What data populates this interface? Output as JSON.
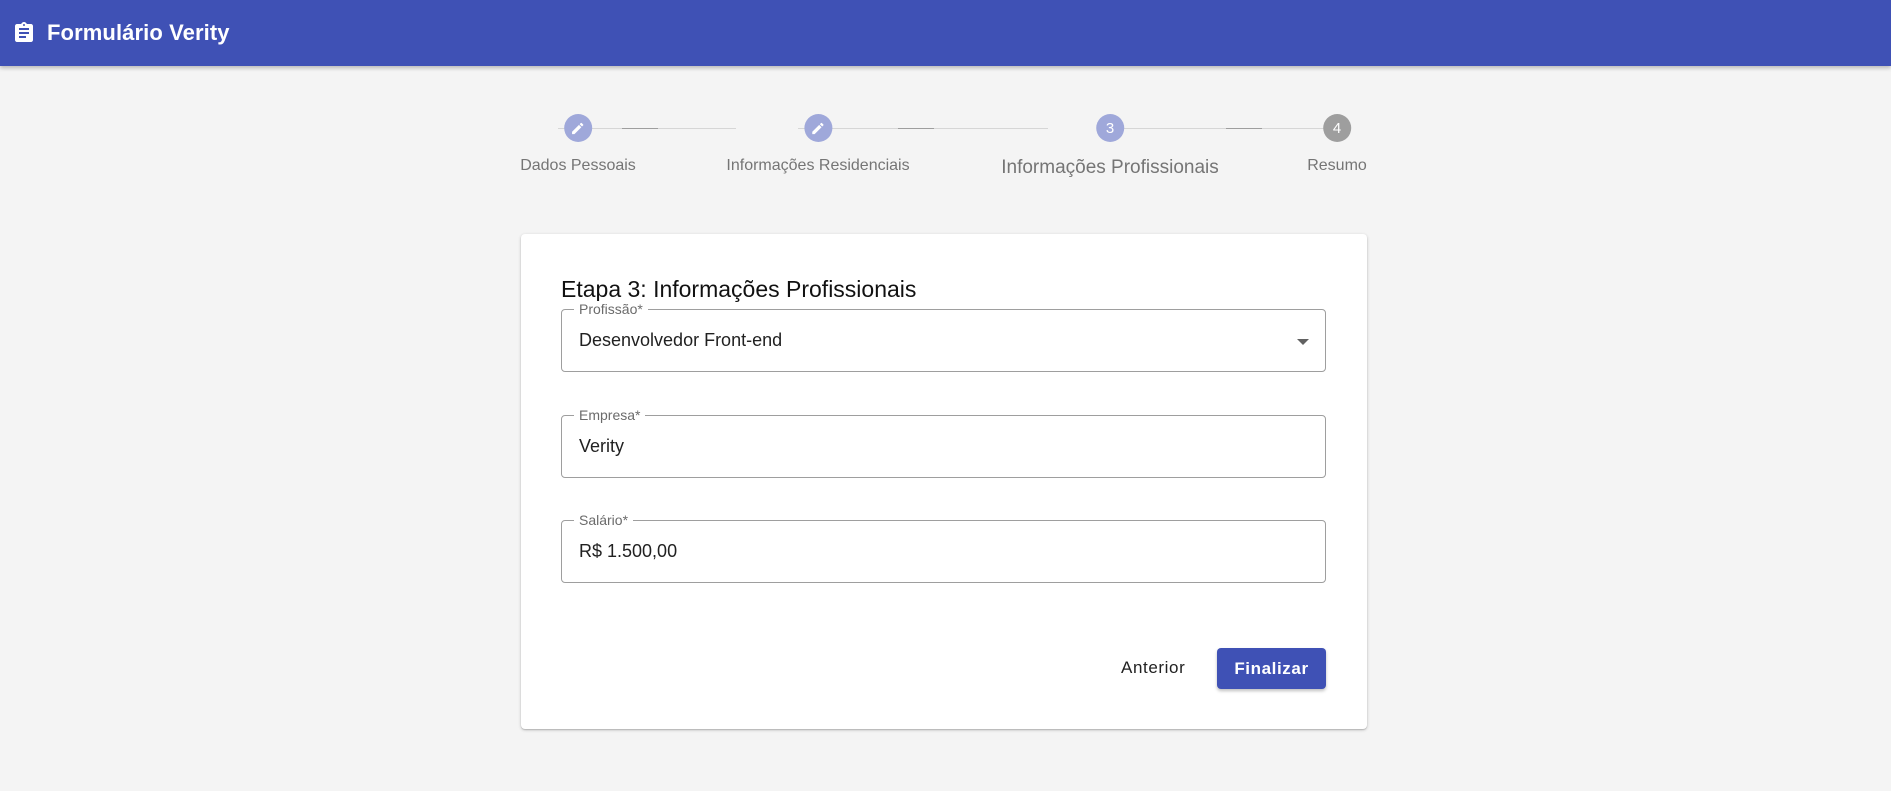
{
  "app": {
    "title": "Formulário Verity",
    "icon": "clipboard-icon",
    "colors": {
      "primary": "#3f51b5",
      "step_done": "#9fa8da",
      "step_pending": "#9e9e9e",
      "background": "#f4f4f4"
    }
  },
  "stepper": {
    "steps": [
      {
        "label": "Dados Pessoais",
        "state": "done",
        "icon": "pencil-icon"
      },
      {
        "label": "Informações Residenciais",
        "state": "done",
        "icon": "pencil-icon"
      },
      {
        "label": "Informações Profissionais",
        "state": "active",
        "number": "3"
      },
      {
        "label": "Resumo",
        "state": "pending",
        "number": "4"
      }
    ]
  },
  "form": {
    "heading": "Etapa 3: Informações Profissionais",
    "fields": {
      "profissao": {
        "label": "Profissão*",
        "value": "Desenvolvedor Front-end"
      },
      "empresa": {
        "label": "Empresa*",
        "value": "Verity"
      },
      "salario": {
        "label": "Salário*",
        "value": "R$ 1.500,00"
      }
    },
    "buttons": {
      "previous": "Anterior",
      "finish": "Finalizar"
    }
  }
}
